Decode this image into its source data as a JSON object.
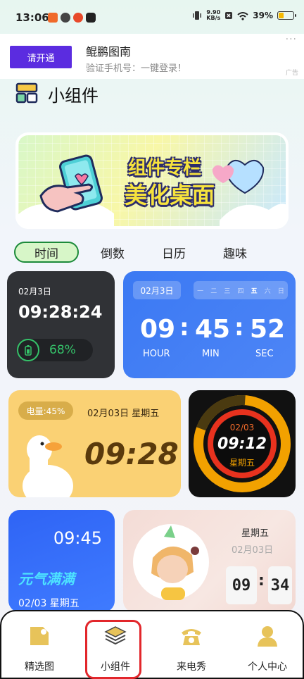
{
  "status_bar": {
    "time": "13:06",
    "net_speed_value": "9.90",
    "net_speed_unit": "KB/s",
    "battery": "39%",
    "battery_level": 0.39
  },
  "ad": {
    "button_label": "请开通",
    "title": "鲲鹏图南",
    "subtitle": "验证手机号：一键登录！",
    "more": "···",
    "tag": "广告"
  },
  "page": {
    "title": "小组件"
  },
  "hero": {
    "line1": "组件专栏",
    "line2": "美化桌面"
  },
  "tabs": [
    {
      "label": "时间",
      "active": true
    },
    {
      "label": "倒数",
      "active": false
    },
    {
      "label": "日历",
      "active": false
    },
    {
      "label": "趣味",
      "active": false
    }
  ],
  "widgets": {
    "w1": {
      "date": "02月3日",
      "time": "09:28:24",
      "battery": "68%"
    },
    "w2": {
      "date": "02月3日",
      "weekdays": [
        "一",
        "二",
        "三",
        "四",
        "五",
        "六",
        "日"
      ],
      "active_weekday": "五",
      "hour": "09",
      "minute": "45",
      "second": "52",
      "sep": ":",
      "hour_label": "HOUR",
      "min_label": "MIN",
      "sec_label": "SEC"
    },
    "w3": {
      "battery": "电量:45%",
      "date": "02月03日 星期五",
      "time": "09:28"
    },
    "w4": {
      "date": "02/03",
      "time": "09:12",
      "weekday": "星期五"
    },
    "w5": {
      "time": "09:45",
      "slogan": "元气满满",
      "date": "02/03 星期五"
    },
    "w6": {
      "weekday": "星期五",
      "date": "02月03日",
      "hour": "09",
      "sep": ":",
      "minute": "34"
    }
  },
  "bottom_nav": [
    {
      "label": "精选图",
      "icon": "gallery-icon"
    },
    {
      "label": "小组件",
      "icon": "layers-icon"
    },
    {
      "label": "来电秀",
      "icon": "phone-icon"
    },
    {
      "label": "个人中心",
      "icon": "user-icon"
    }
  ],
  "colors": {
    "accent_green": "#1c8a3a",
    "nav_icon": "#e7c35a",
    "highlight_red": "#e2262b"
  }
}
